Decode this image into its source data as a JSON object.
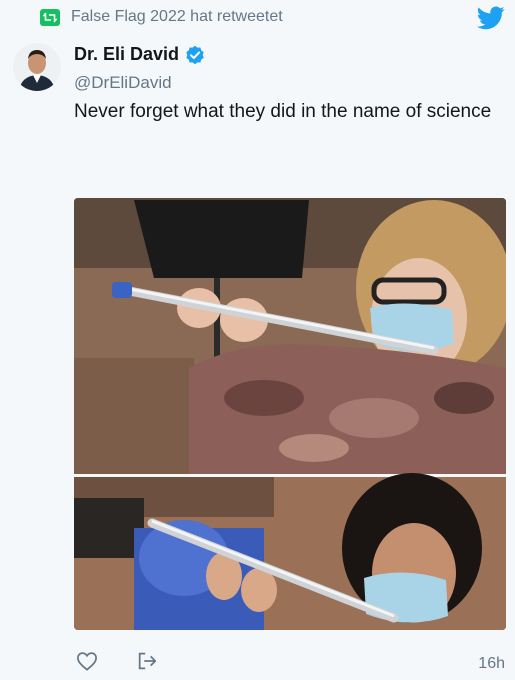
{
  "retweet": {
    "icon": "retweet-icon",
    "text": "False Flag 2022 hat retweetet"
  },
  "header": {
    "logo_icon": "twitter-bird-icon",
    "accent_color": "#1da1f2"
  },
  "author": {
    "display_name": "Dr. Eli David",
    "handle": "@DrEliDavid",
    "verified_icon": "verified-badge-icon"
  },
  "tweet": {
    "text": "Never forget what they did in the name of science"
  },
  "media": {
    "count": 1,
    "panels": 2
  },
  "actions": {
    "like_icon": "heart-icon",
    "share_icon": "share-icon",
    "timestamp": "16h"
  },
  "colors": {
    "retweet_green": "#17bf63",
    "text_primary": "#14171a",
    "text_secondary": "#657786",
    "background": "#f5f8fa"
  }
}
